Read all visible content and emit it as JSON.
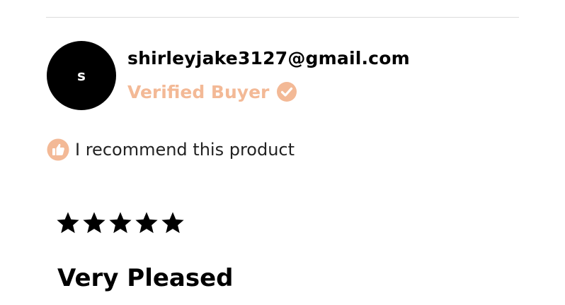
{
  "reviewer": {
    "avatar_initial": "s",
    "email": "shirleyjake3127@gmail.com",
    "verified_label": "Verified Buyer"
  },
  "recommendation": {
    "text": "I recommend this product"
  },
  "review": {
    "rating": 5,
    "rating_max": 5,
    "title": "Very Pleased"
  },
  "colors": {
    "accent": "#f3b996",
    "avatar_bg": "#000000",
    "divider": "#dcdcdc"
  },
  "icons": {
    "verified": "check-circle-icon",
    "recommend": "thumbs-up-icon",
    "rating": "star-icon"
  }
}
